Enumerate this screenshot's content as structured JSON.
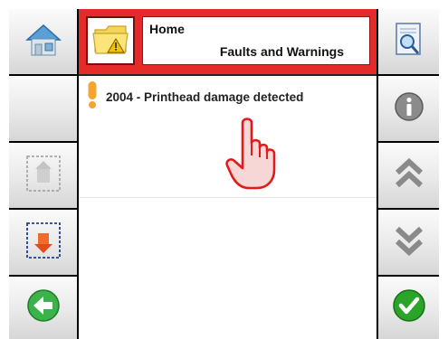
{
  "header": {
    "title": "Home",
    "subtitle": "Faults and Warnings",
    "icon": "folder-warning-icon"
  },
  "faults": [
    {
      "icon": "warning-exclamation-icon",
      "text": "2004 - Printhead damage detected"
    }
  ],
  "left_buttons": [
    {
      "icon": "home-icon",
      "enabled": true
    },
    {
      "icon": "blank",
      "enabled": false
    },
    {
      "icon": "page-up-icon",
      "enabled": false
    },
    {
      "icon": "page-down-icon",
      "enabled": true
    },
    {
      "icon": "back-arrow-icon",
      "enabled": true
    }
  ],
  "right_buttons": [
    {
      "icon": "report-search-icon",
      "enabled": true
    },
    {
      "icon": "info-icon",
      "enabled": true
    },
    {
      "icon": "scroll-up-icon",
      "enabled": true
    },
    {
      "icon": "scroll-down-icon",
      "enabled": true
    },
    {
      "icon": "confirm-check-icon",
      "enabled": true
    }
  ],
  "colors": {
    "header_red": "#e52a2a",
    "warning_orange": "#f5a431",
    "accept_green": "#2aa52a",
    "back_green": "#3bb34a"
  }
}
